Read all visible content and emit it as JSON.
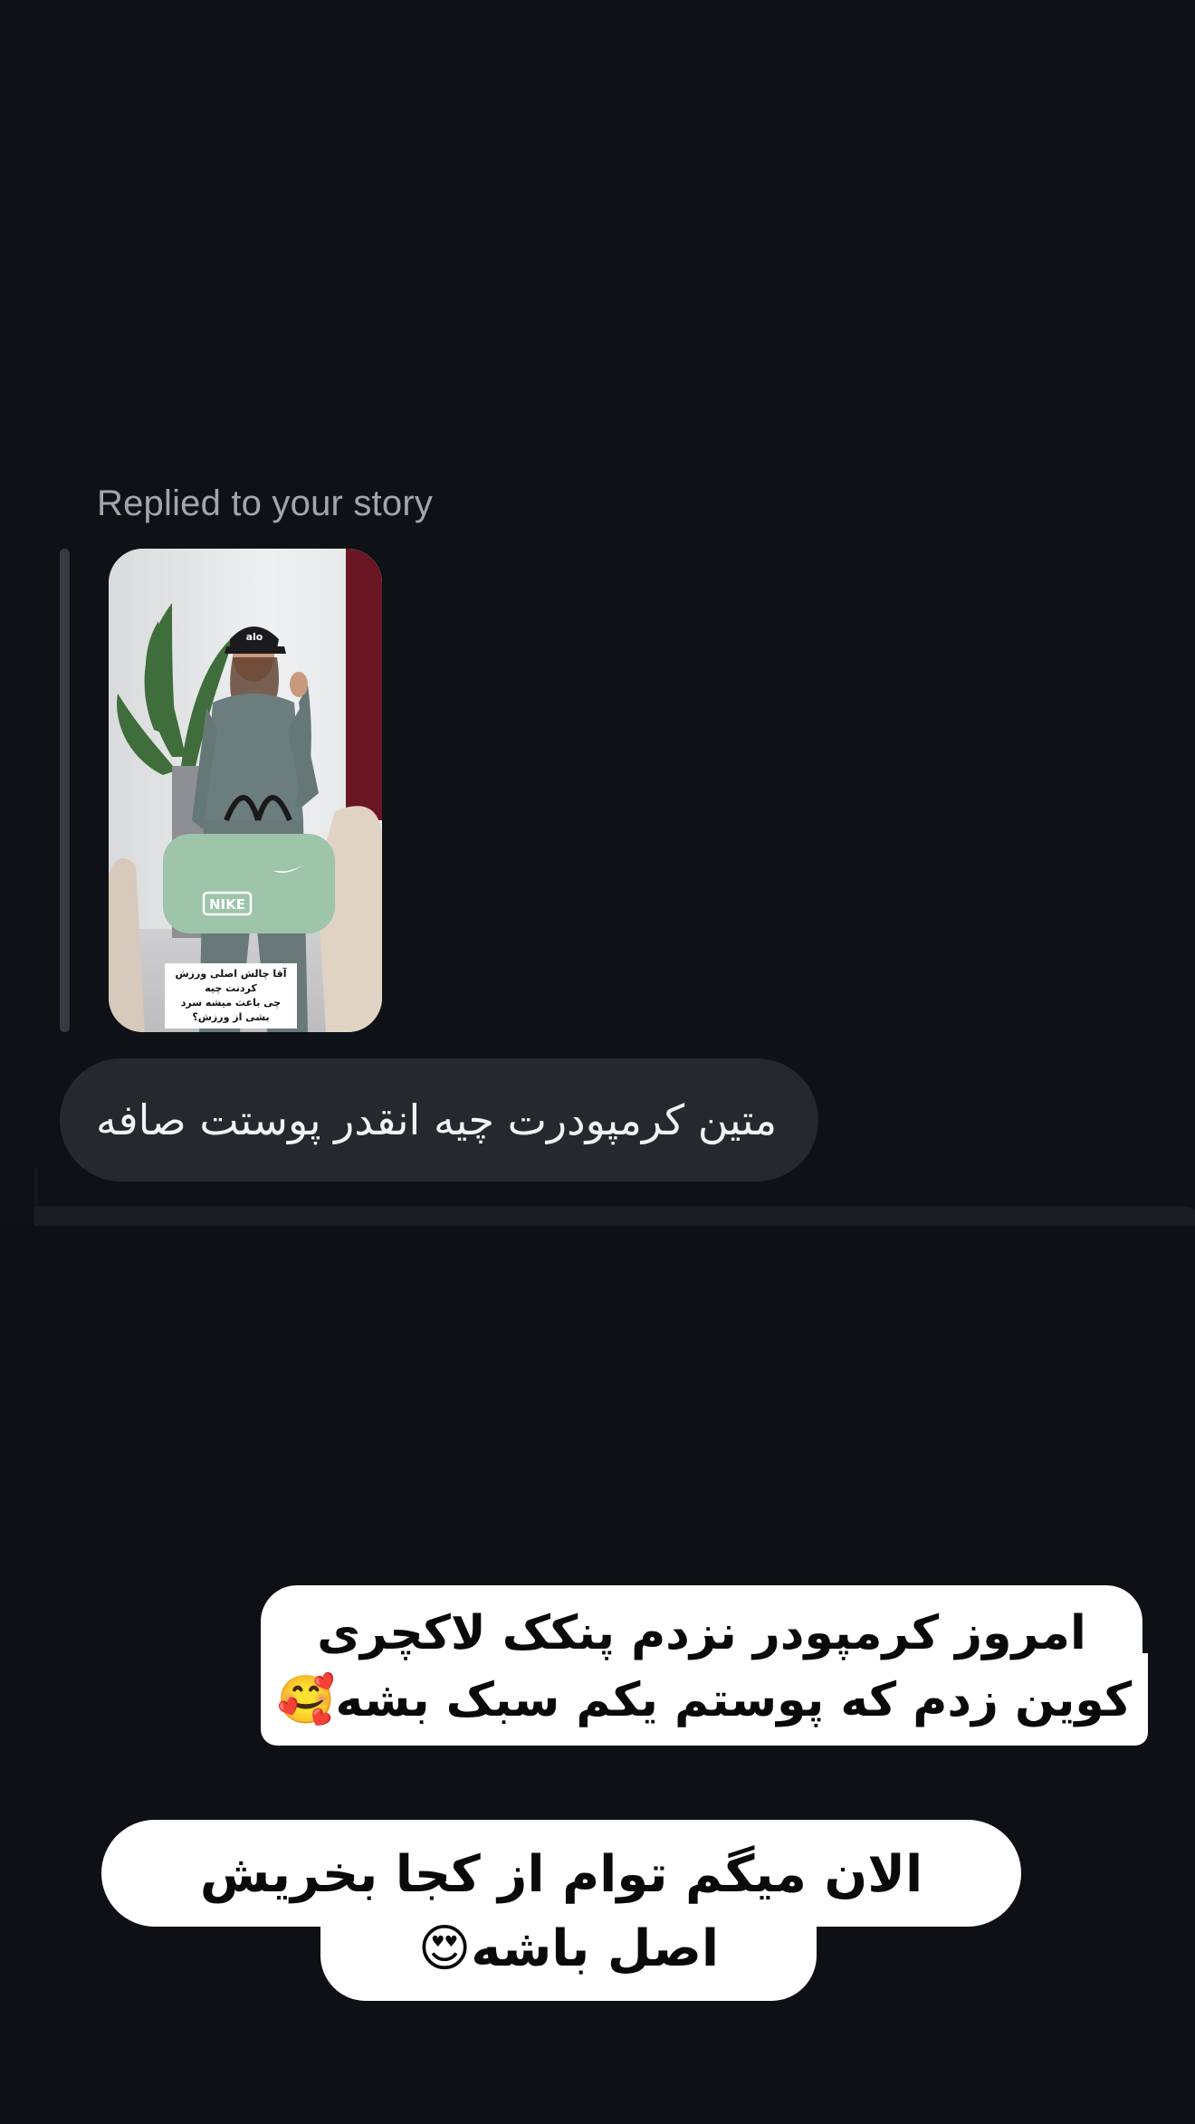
{
  "thread": {
    "replied_label": "Replied to your story",
    "story_caption_line1": "آقا چالش اصلی ورزش کردنت چیه",
    "story_caption_line2": "چی باعث میشه سرد بشی از ورزش؟",
    "story_cap_text": "alo",
    "story_bag_text": "NIKE",
    "reply_message": "متین کرمپودرت چیه انقدر پوستت صافه"
  },
  "sticker_one": {
    "line1": "امروز کرمپودر نزدم پنکک لاکچری",
    "line2": "کوین زدم که پوستم یکم سبک بشه",
    "emoji": "🥰"
  },
  "sticker_two": {
    "line1": "الان میگم توام از کجا بخریش",
    "line2": "اصل باشه",
    "emoji": "😍"
  },
  "colors": {
    "background": "#0e1015",
    "bubble": "#25282d",
    "label": "#a1a6ae",
    "sticker": "#ffffff"
  }
}
